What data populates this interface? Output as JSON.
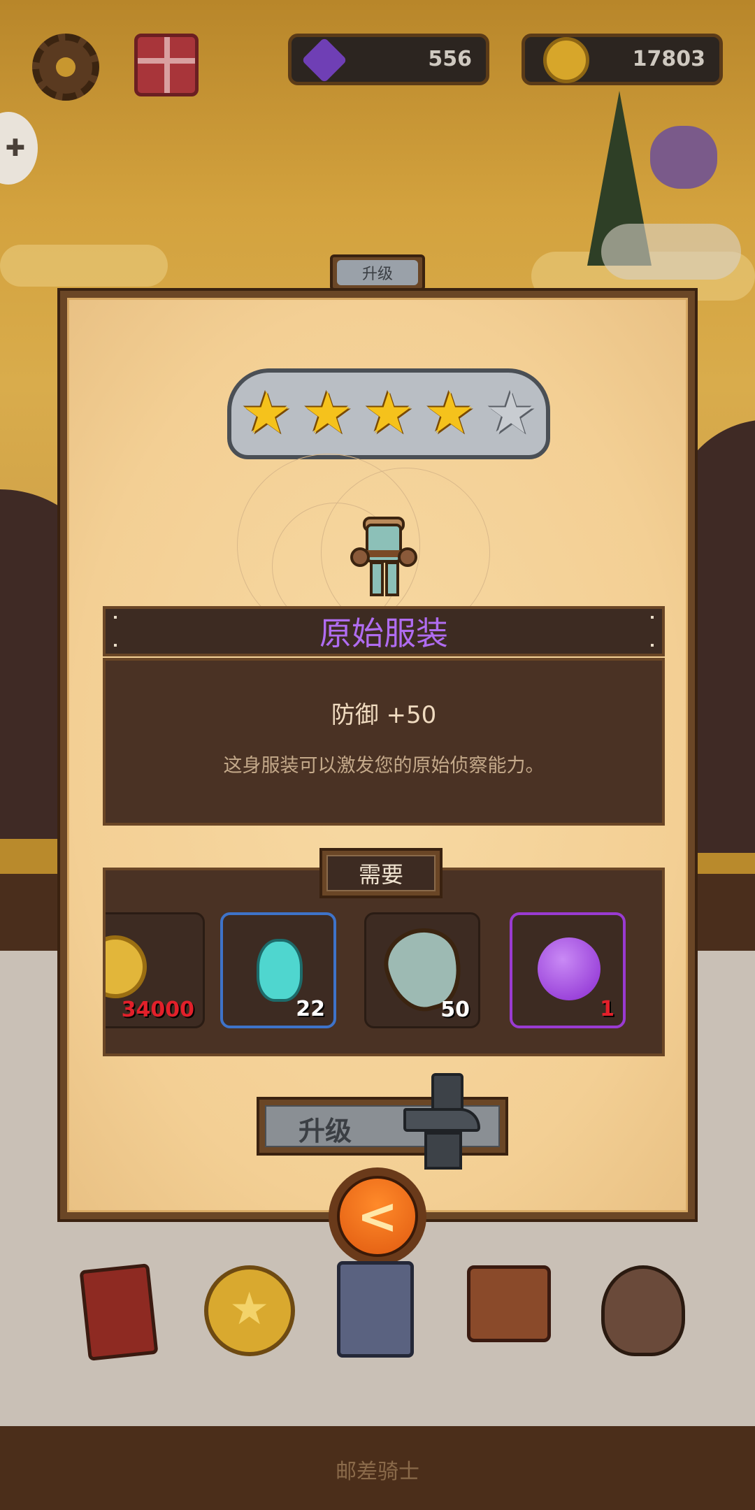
{
  "hud": {
    "gems": "556",
    "coins": "17803"
  },
  "panel": {
    "tab_label": "升级",
    "stars_filled": 4,
    "stars_total": 5,
    "item_name": "原始服装",
    "stat": "防御 +50",
    "description": "这身服装可以激发您的原始侦察能力。",
    "requirements_label": "需要",
    "requirements": [
      {
        "icon": "gold-coin-icon",
        "qty": "34000",
        "qty_color": "#e2202a"
      },
      {
        "icon": "cyan-crystal-icon",
        "qty": "22",
        "qty_color": "#ffffff"
      },
      {
        "icon": "leaf-shield-icon",
        "qty": "50",
        "qty_color": "#ffffff"
      },
      {
        "icon": "purple-orb-icon",
        "qty": "1",
        "qty_color": "#e2202a"
      }
    ],
    "upgrade_button": "升级",
    "back_icon": "<"
  },
  "nav": [
    {
      "icon": "journal-book-icon"
    },
    {
      "icon": "star-coin-icon"
    },
    {
      "icon": "card-deck-icon"
    },
    {
      "icon": "inventory-bag-icon"
    },
    {
      "icon": "shop-loot-icon"
    }
  ],
  "footer": {
    "game_title": "邮差骑士"
  },
  "colors": {
    "accent_purple": "#b06cf0",
    "star_gold": "#f5c21c",
    "shortage_red": "#e2202a"
  }
}
